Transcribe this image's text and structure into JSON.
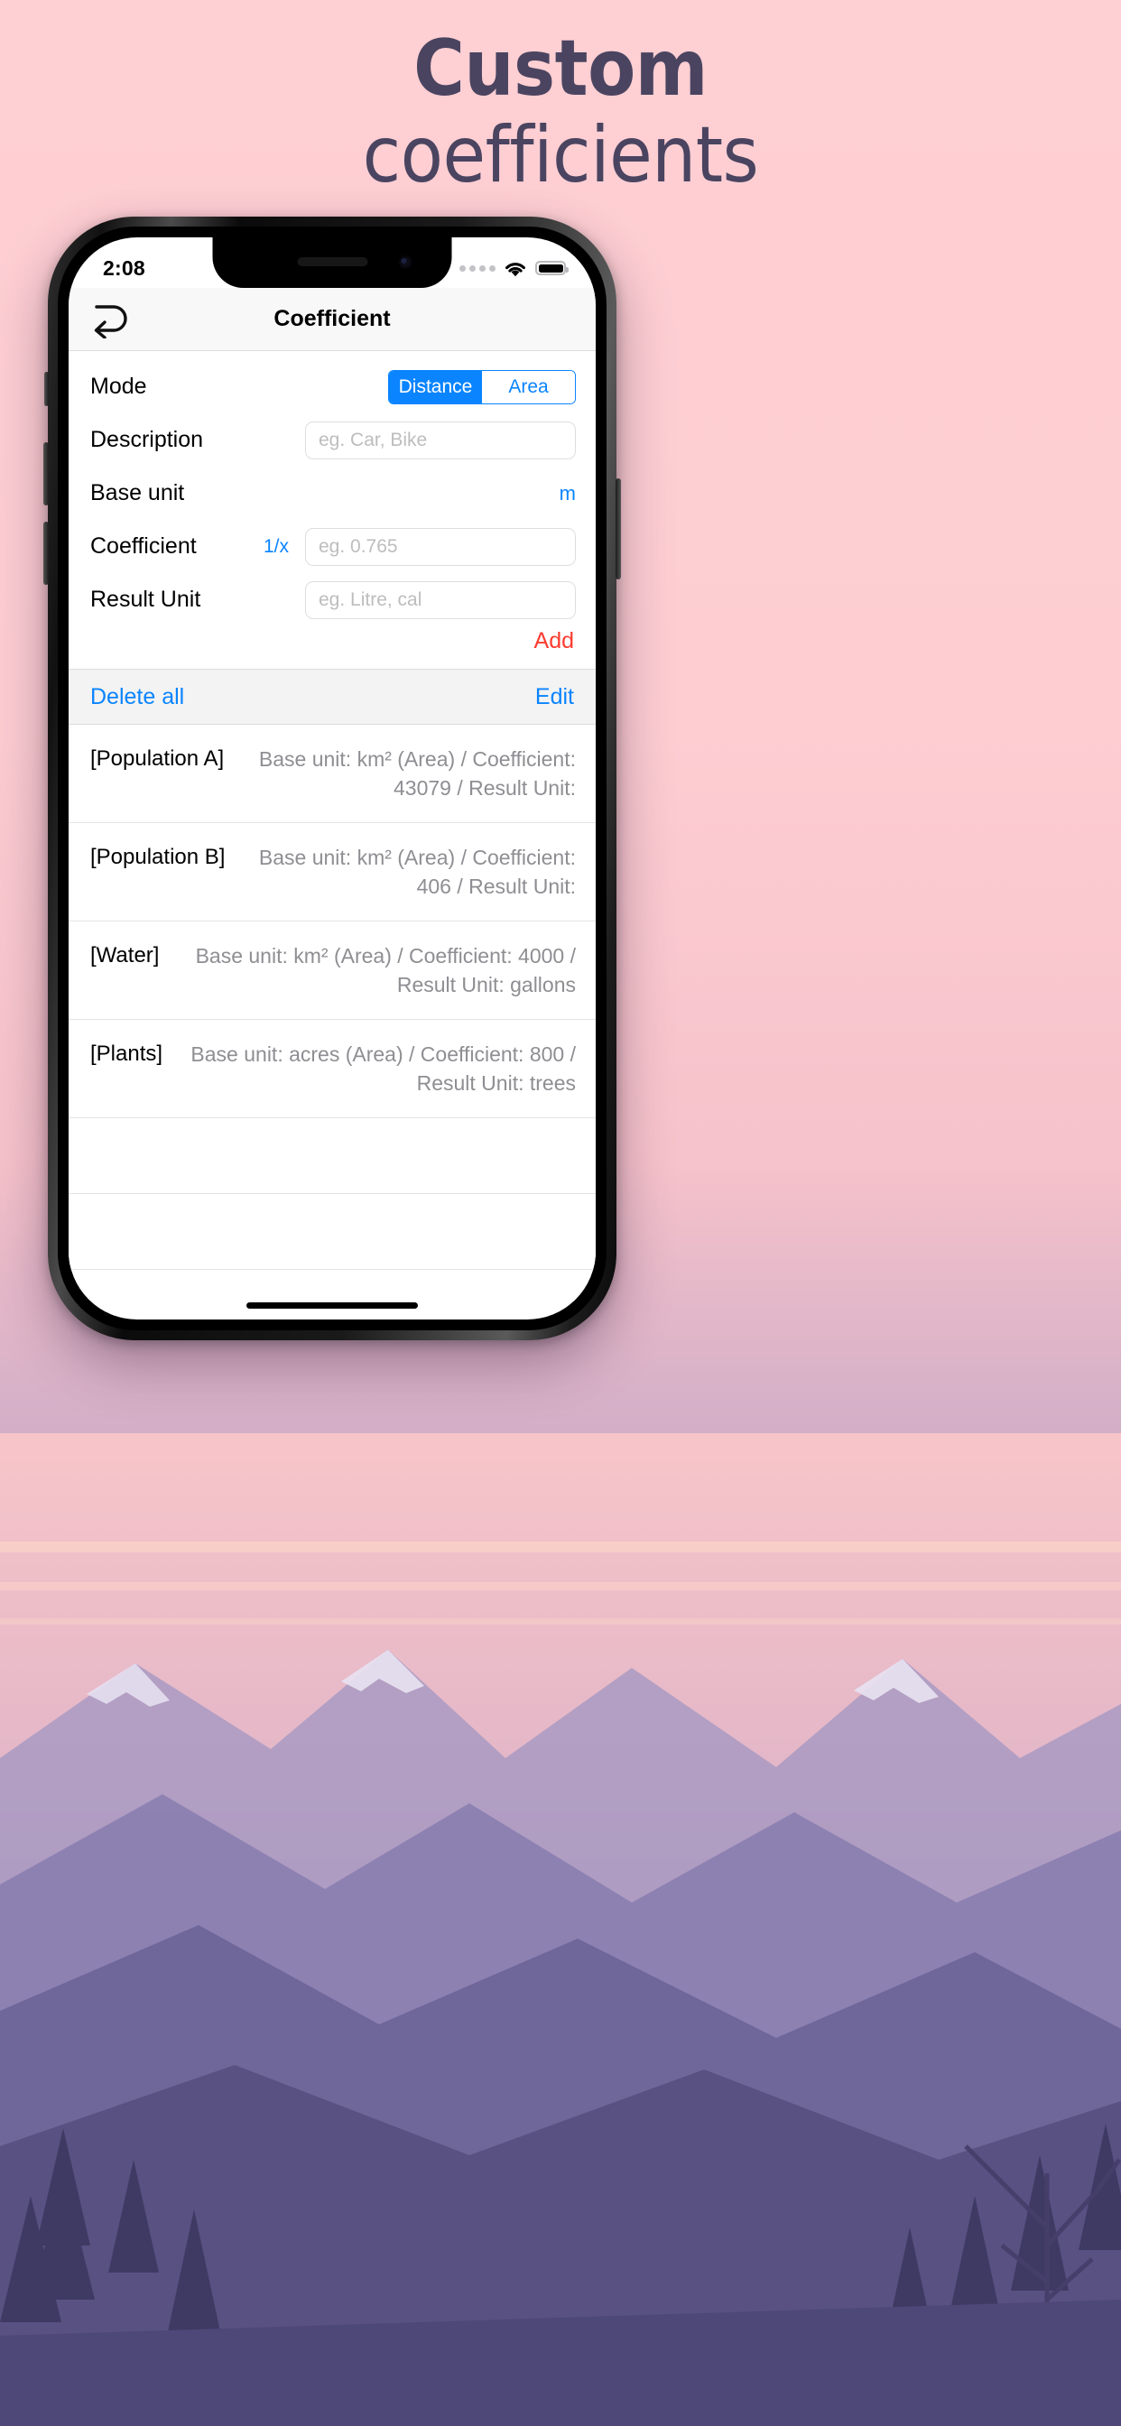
{
  "poster": {
    "headline_line1": "Custom",
    "headline_line2": "coefficients",
    "headline_color": "#4a4460",
    "background_top_color": "#fecfd3",
    "background_bottom_color": "#4d4a7d"
  },
  "statusbar": {
    "time": "2:08",
    "signal_icon": "signal-dots-icon",
    "wifi_icon": "wifi-icon",
    "battery_icon": "battery-icon"
  },
  "navbar": {
    "back_icon": "undo-back-arrow-icon",
    "title": "Coefficient"
  },
  "form": {
    "mode": {
      "label": "Mode",
      "options": [
        "Distance",
        "Area"
      ],
      "selected": "Distance"
    },
    "description": {
      "label": "Description",
      "placeholder": "eg. Car, Bike",
      "value": ""
    },
    "base_unit": {
      "label": "Base unit",
      "value": "m",
      "value_color": "#0a84ff"
    },
    "coefficient": {
      "label": "Coefficient",
      "inverse_toggle": "1/x",
      "placeholder": "eg. 0.765",
      "value": ""
    },
    "result_unit": {
      "label": "Result Unit",
      "placeholder": "eg. Litre, cal",
      "value": ""
    },
    "add_label": "Add",
    "add_color": "#ff3b30"
  },
  "toolbar": {
    "delete_all_label": "Delete all",
    "edit_label": "Edit",
    "accent_color": "#0a84ff"
  },
  "list": {
    "items": [
      {
        "name": "[Population A]",
        "detail": "Base unit: km² (Area) / Coefficient: 43079 / Result Unit:"
      },
      {
        "name": "[Population B]",
        "detail": "Base unit: km² (Area) / Coefficient: 406 / Result Unit:"
      },
      {
        "name": "[Water]",
        "detail": "Base unit: km² (Area) / Coefficient: 4000 / Result Unit: gallons"
      },
      {
        "name": "[Plants]",
        "detail": "Base unit: acres (Area) / Coefficient: 800 / Result Unit: trees"
      },
      {
        "name": "",
        "detail": ""
      },
      {
        "name": "",
        "detail": ""
      }
    ]
  }
}
